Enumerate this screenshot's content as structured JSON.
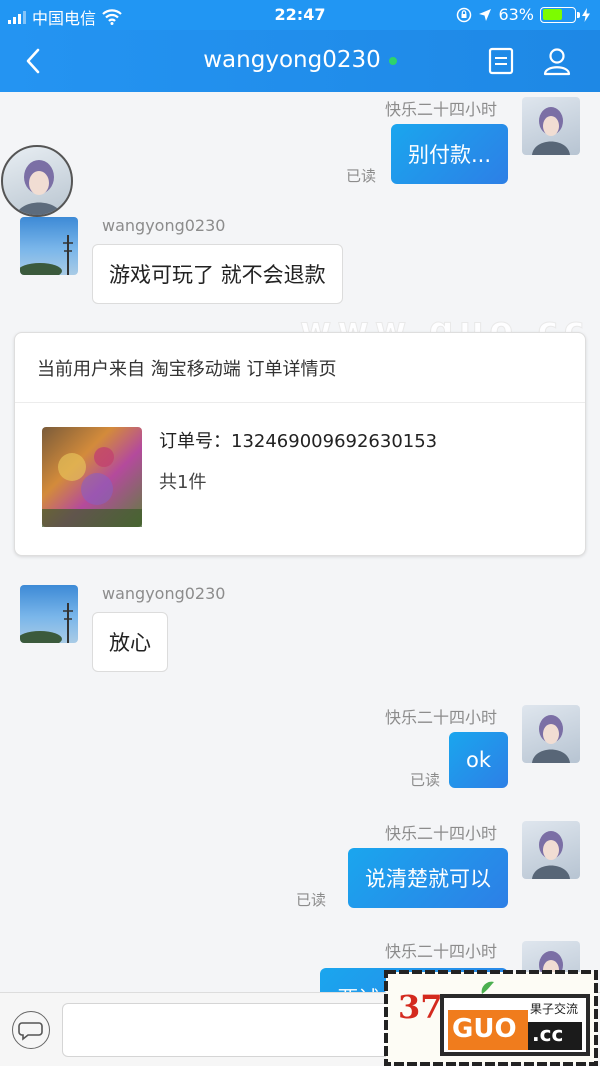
{
  "status_bar": {
    "carrier": "中国电信",
    "time": "22:47",
    "battery_percent": "63%",
    "battery_level": 0.63
  },
  "nav": {
    "title": "wangyong0230",
    "online_color": "#2ed36b"
  },
  "messages": [
    {
      "sender": "快乐二十四小时",
      "text": "别付款...",
      "read": "已读"
    },
    {
      "sender": "wangyong0230",
      "text": "游戏可玩了 就不会退款"
    },
    {
      "sender": "wangyong0230",
      "text": "放心"
    },
    {
      "sender": "快乐二十四小时",
      "text": "ok",
      "read": "已读"
    },
    {
      "sender": "快乐二十四小时",
      "text": "说清楚就可以",
      "read": "已读"
    },
    {
      "sender": "快乐二十四小时",
      "text": "要试多 做好这哪"
    }
  ],
  "order_card": {
    "header": "当前用户来自 淘宝移动端 订单详情页",
    "order_number": "订单号：132469009692630153",
    "count": "共1件"
  },
  "watermark_text": "www.guo.cc",
  "logo": {
    "number": "37",
    "brand": "GUO",
    "domain": ".cc",
    "tagline": "果子交流"
  },
  "colors": {
    "accent": "#2196f3",
    "bubble_blue": "#1e90ea",
    "background": "#f4f5f7"
  },
  "icons": [
    "back-chevron-icon",
    "document-icon",
    "user-icon",
    "chat-bubble-icon"
  ]
}
